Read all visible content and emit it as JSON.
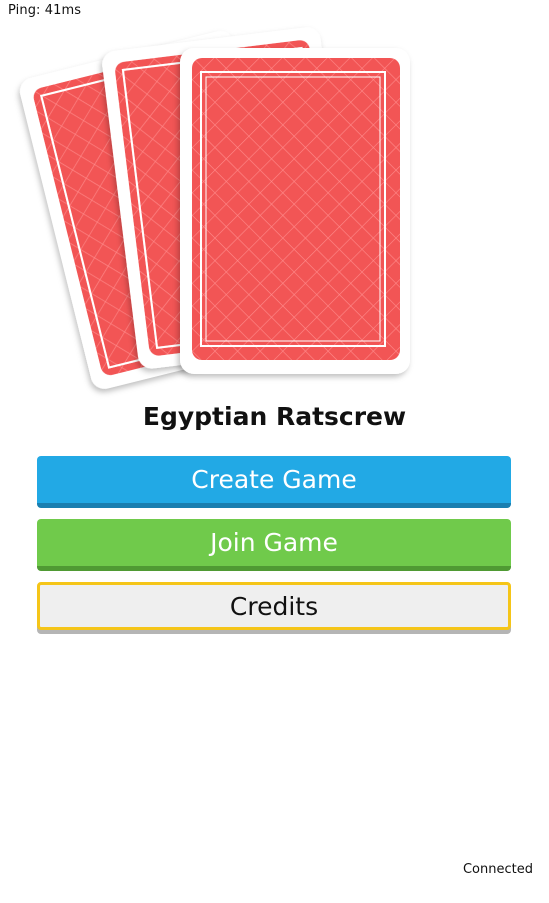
{
  "status": {
    "ping": "Ping: 41ms",
    "connection": "Connected"
  },
  "title": "Egyptian Ratscrew",
  "menu": {
    "create_label": "Create Game",
    "join_label": "Join Game",
    "credits_label": "Credits"
  },
  "colors": {
    "card_back": "#f25555",
    "create": "#22a9e5",
    "join": "#70ca4b",
    "credits_border": "#f5c518"
  }
}
